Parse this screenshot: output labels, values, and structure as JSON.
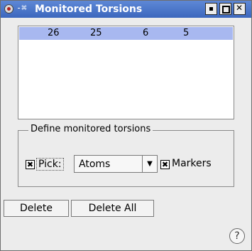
{
  "window": {
    "title": "Monitored Torsions"
  },
  "torsion_list": {
    "rows": [
      [
        "26",
        "25",
        "6",
        "5"
      ]
    ]
  },
  "define_group": {
    "legend": "Define monitored torsions",
    "pick": {
      "label": "Pick:",
      "checked": true
    },
    "mode": {
      "selected": "Atoms"
    },
    "markers": {
      "label": "Markers",
      "checked": true
    }
  },
  "buttons": {
    "delete": "Delete",
    "delete_all": "Delete All"
  },
  "help": {
    "glyph": "?"
  },
  "icons": {
    "check": "✖",
    "arrow": "▼"
  }
}
